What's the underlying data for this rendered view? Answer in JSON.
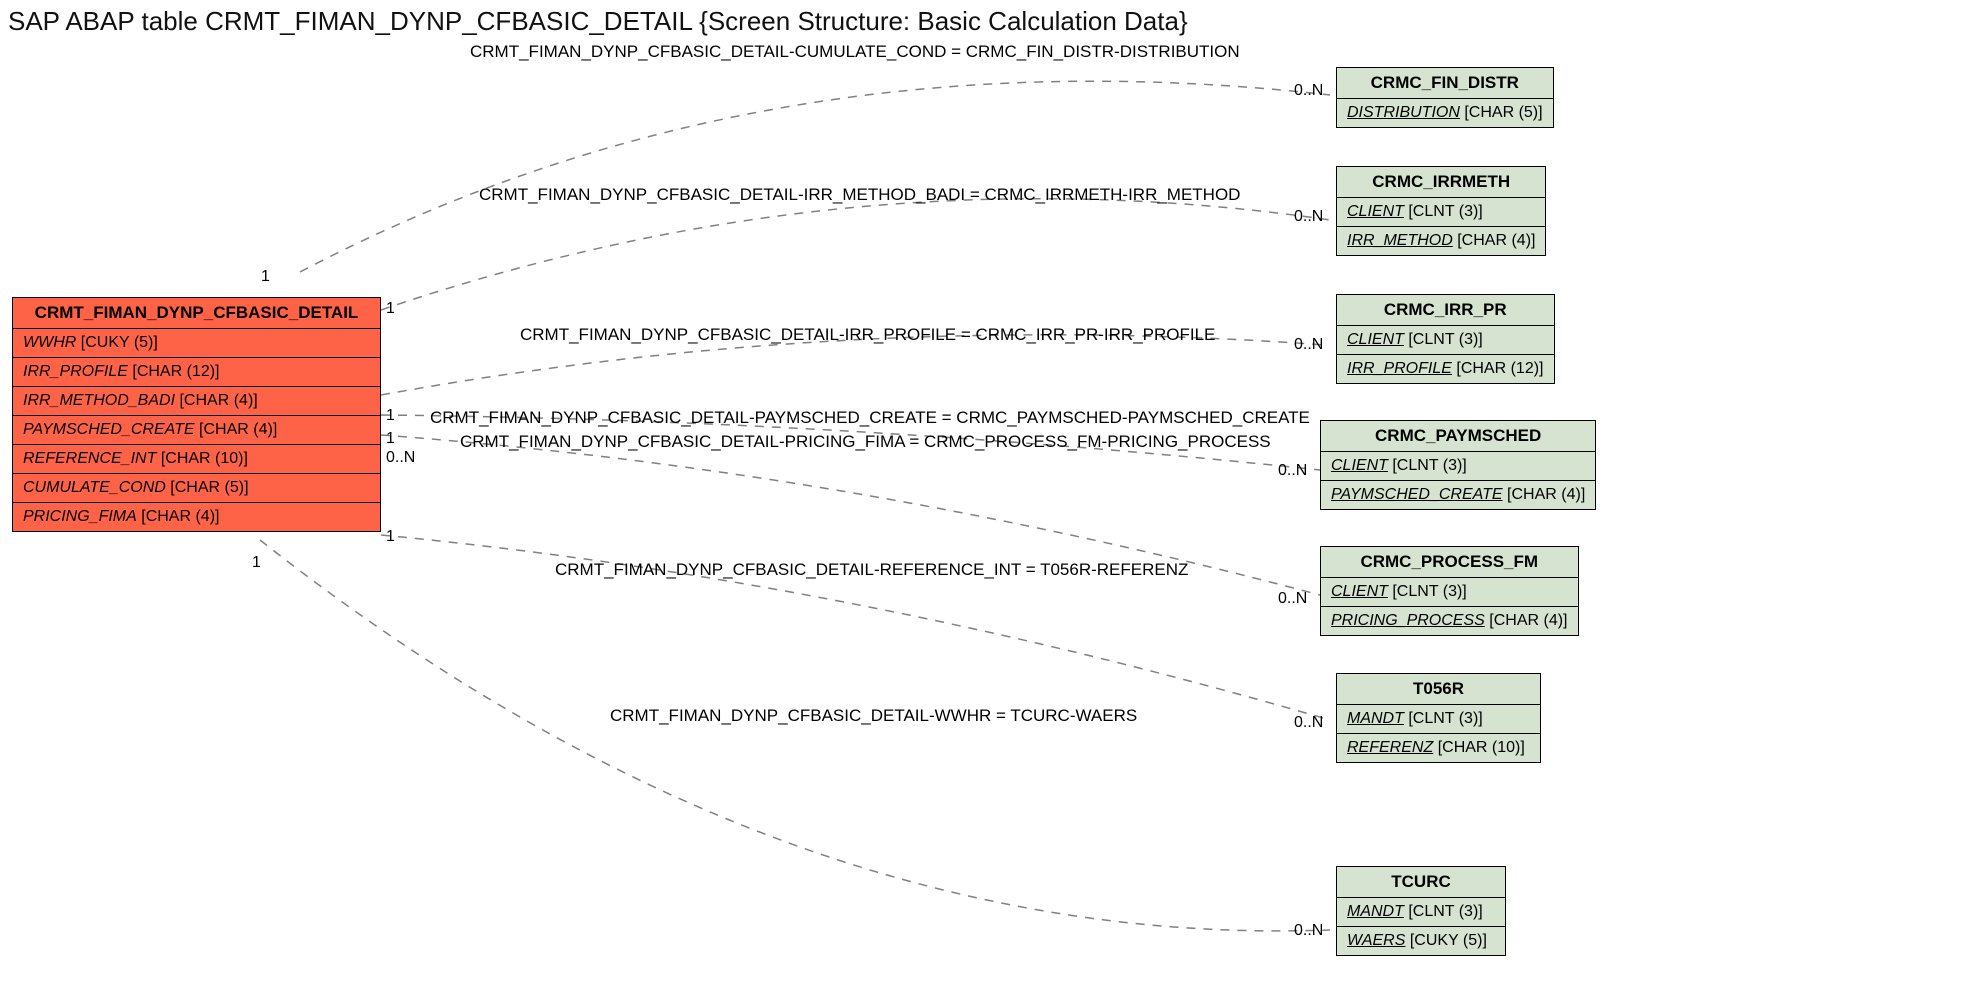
{
  "title": "SAP ABAP table CRMT_FIMAN_DYNP_CFBASIC_DETAIL {Screen Structure: Basic Calculation Data}",
  "main": {
    "name": "CRMT_FIMAN_DYNP_CFBASIC_DETAIL",
    "fields": [
      {
        "n": "WWHR",
        "t": "[CUKY (5)]"
      },
      {
        "n": "IRR_PROFILE",
        "t": "[CHAR (12)]"
      },
      {
        "n": "IRR_METHOD_BADI",
        "t": "[CHAR (4)]"
      },
      {
        "n": "PAYMSCHED_CREATE",
        "t": "[CHAR (4)]"
      },
      {
        "n": "REFERENCE_INT",
        "t": "[CHAR (10)]"
      },
      {
        "n": "CUMULATE_COND",
        "t": "[CHAR (5)]"
      },
      {
        "n": "PRICING_FIMA",
        "t": "[CHAR (4)]"
      }
    ]
  },
  "refs": [
    {
      "name": "CRMC_FIN_DISTR",
      "fields": [
        {
          "n": "DISTRIBUTION",
          "t": "[CHAR (5)]",
          "u": true
        }
      ]
    },
    {
      "name": "CRMC_IRRMETH",
      "fields": [
        {
          "n": "CLIENT",
          "t": "[CLNT (3)]",
          "u": true
        },
        {
          "n": "IRR_METHOD",
          "t": "[CHAR (4)]",
          "u": true
        }
      ]
    },
    {
      "name": "CRMC_IRR_PR",
      "fields": [
        {
          "n": "CLIENT",
          "t": "[CLNT (3)]",
          "u": true
        },
        {
          "n": "IRR_PROFILE",
          "t": "[CHAR (12)]",
          "u": true
        }
      ]
    },
    {
      "name": "CRMC_PAYMSCHED",
      "fields": [
        {
          "n": "CLIENT",
          "t": "[CLNT (3)]",
          "u": true
        },
        {
          "n": "PAYMSCHED_CREATE",
          "t": "[CHAR (4)]",
          "u": true
        }
      ]
    },
    {
      "name": "CRMC_PROCESS_FM",
      "fields": [
        {
          "n": "CLIENT",
          "t": "[CLNT (3)]",
          "u": true
        },
        {
          "n": "PRICING_PROCESS",
          "t": "[CHAR (4)]",
          "u": true
        }
      ]
    },
    {
      "name": "T056R",
      "fields": [
        {
          "n": "MANDT",
          "t": "[CLNT (3)]",
          "iu": true
        },
        {
          "n": "REFERENZ",
          "t": "[CHAR (10)]",
          "u": true
        }
      ]
    },
    {
      "name": "TCURC",
      "fields": [
        {
          "n": "MANDT",
          "t": "[CLNT (3)]",
          "iu": true
        },
        {
          "n": "WAERS",
          "t": "[CUKY (5)]",
          "u": true
        }
      ]
    }
  ],
  "rels": [
    "CRMT_FIMAN_DYNP_CFBASIC_DETAIL-CUMULATE_COND = CRMC_FIN_DISTR-DISTRIBUTION",
    "CRMT_FIMAN_DYNP_CFBASIC_DETAIL-IRR_METHOD_BADI = CRMC_IRRMETH-IRR_METHOD",
    "CRMT_FIMAN_DYNP_CFBASIC_DETAIL-IRR_PROFILE = CRMC_IRR_PR-IRR_PROFILE",
    "CRMT_FIMAN_DYNP_CFBASIC_DETAIL-PAYMSCHED_CREATE = CRMC_PAYMSCHED-PAYMSCHED_CREATE",
    "CRMT_FIMAN_DYNP_CFBASIC_DETAIL-PRICING_FIMA = CRMC_PROCESS_FM-PRICING_PROCESS",
    "CRMT_FIMAN_DYNP_CFBASIC_DETAIL-REFERENCE_INT = T056R-REFERENZ",
    "CRMT_FIMAN_DYNP_CFBASIC_DETAIL-WWHR = TCURC-WAERS"
  ],
  "cards": {
    "one": "1",
    "zn": "0..N"
  },
  "chart_data": {
    "type": "erd",
    "source_table": "CRMT_FIMAN_DYNP_CFBASIC_DETAIL",
    "description": "Screen Structure: Basic Calculation Data",
    "relationships": [
      {
        "from_field": "CUMULATE_COND",
        "to_table": "CRMC_FIN_DISTR",
        "to_field": "DISTRIBUTION",
        "from_card": "1",
        "to_card": "0..N"
      },
      {
        "from_field": "IRR_METHOD_BADI",
        "to_table": "CRMC_IRRMETH",
        "to_field": "IRR_METHOD",
        "from_card": "1",
        "to_card": "0..N"
      },
      {
        "from_field": "IRR_PROFILE",
        "to_table": "CRMC_IRR_PR",
        "to_field": "IRR_PROFILE",
        "from_card": "1",
        "to_card": "0..N"
      },
      {
        "from_field": "PAYMSCHED_CREATE",
        "to_table": "CRMC_PAYMSCHED",
        "to_field": "PAYMSCHED_CREATE",
        "from_card": "1",
        "to_card": "0..N"
      },
      {
        "from_field": "PRICING_FIMA",
        "to_table": "CRMC_PROCESS_FM",
        "to_field": "PRICING_PROCESS",
        "from_card": "0..N",
        "to_card": "0..N"
      },
      {
        "from_field": "REFERENCE_INT",
        "to_table": "T056R",
        "to_field": "REFERENZ",
        "from_card": "1",
        "to_card": "0..N"
      },
      {
        "from_field": "WWHR",
        "to_table": "TCURC",
        "to_field": "WAERS",
        "from_card": "1",
        "to_card": "0..N"
      }
    ]
  }
}
